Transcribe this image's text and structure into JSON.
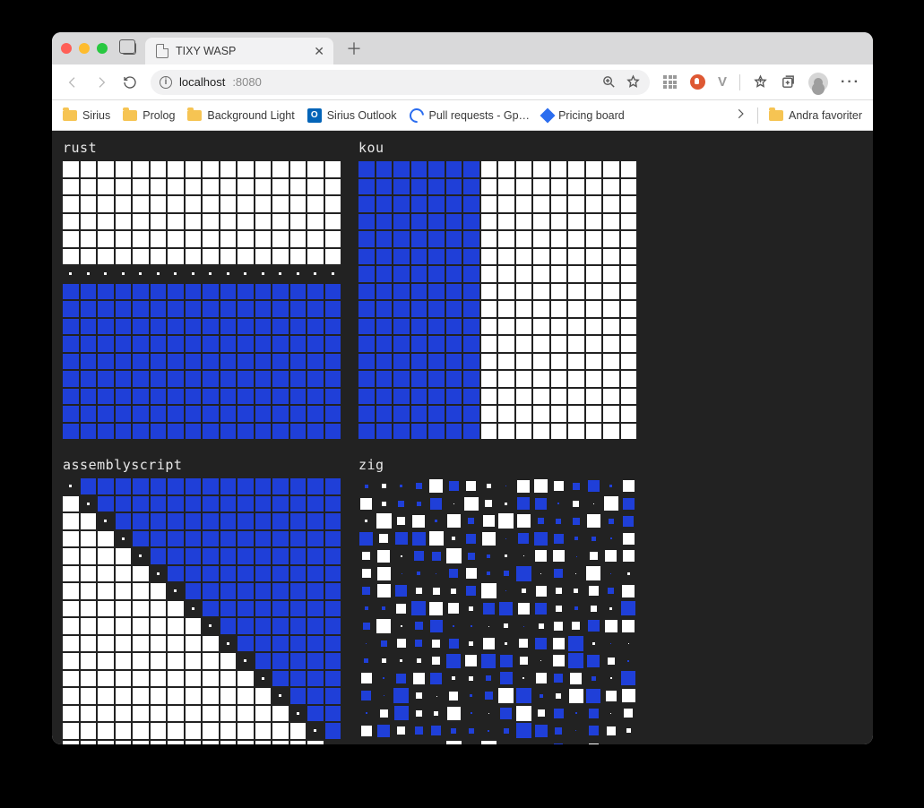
{
  "window": {
    "tab_title": "TIXY WASP",
    "new_tab_tooltip": "New Tab"
  },
  "address": {
    "host": "localhost",
    "port": ":8080"
  },
  "bookmarks": {
    "items": [
      {
        "type": "folder",
        "label": "Sirius"
      },
      {
        "type": "folder",
        "label": "Prolog"
      },
      {
        "type": "folder",
        "label": "Background Light"
      },
      {
        "type": "outlook",
        "label": "Sirius Outlook"
      },
      {
        "type": "github",
        "label": "Pull requests - Gp…"
      },
      {
        "type": "diamond",
        "label": "Pricing board"
      }
    ],
    "overflow_label": "Andra favoriter"
  },
  "colors": {
    "blue": "#1f3fd8",
    "white": "#ffffff",
    "bg": "#222222"
  },
  "panels": [
    {
      "id": "rust",
      "title": "rust",
      "grid": {
        "cols": 16,
        "rows": 16,
        "cell": 17.5
      },
      "fn": "rust"
    },
    {
      "id": "kou",
      "title": "kou",
      "grid": {
        "cols": 16,
        "rows": 16,
        "cell": 17.5
      },
      "fn": "kou"
    },
    {
      "id": "assemblyscript",
      "title": "assemblyscript",
      "grid": {
        "cols": 16,
        "rows": 16,
        "cell": 17.5
      },
      "fn": "asc"
    },
    {
      "id": "zig",
      "title": "zig",
      "grid": {
        "cols": 16,
        "rows": 16,
        "cell": 17.5
      },
      "fn": "zig"
    }
  ]
}
